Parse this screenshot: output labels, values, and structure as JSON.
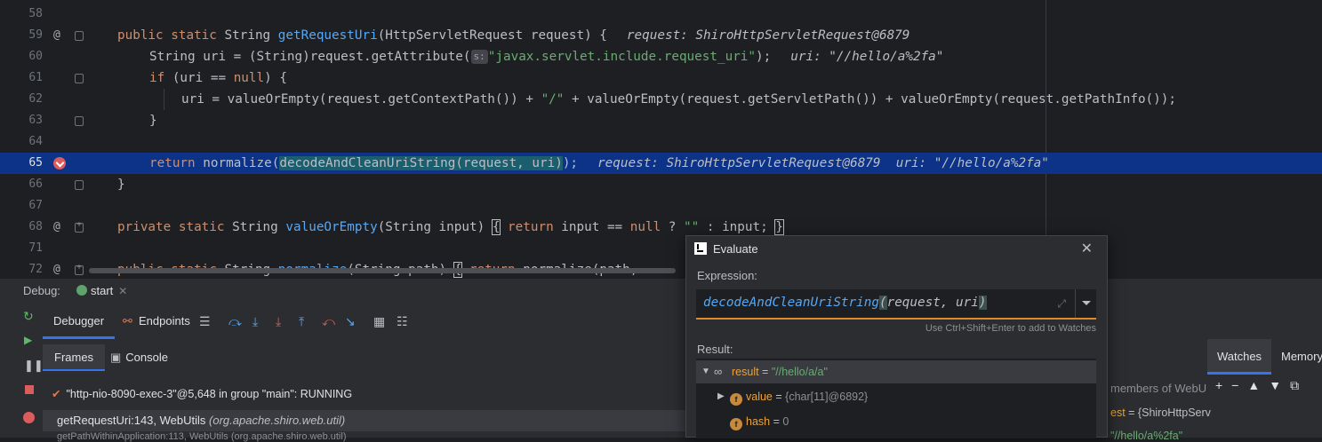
{
  "editor": {
    "lines": [
      {
        "num": "58"
      },
      {
        "num": "59"
      },
      {
        "num": "60"
      },
      {
        "num": "61"
      },
      {
        "num": "62"
      },
      {
        "num": "63"
      },
      {
        "num": "64"
      },
      {
        "num": "65"
      },
      {
        "num": "66"
      },
      {
        "num": "67"
      },
      {
        "num": "68"
      },
      {
        "num": "71"
      },
      {
        "num": "72"
      }
    ],
    "l59": {
      "kw": "public static",
      "sig1": " String ",
      "fn": "getRequestUri",
      "sig2": "(HttpServletRequest request) {",
      "hint": "request: ShiroHttpServletRequest@6879"
    },
    "l60": {
      "pre": "String uri = (String)request.getAttribute(",
      "tag": "s:",
      "str": "\"javax.servlet.include.request_uri\"",
      "post": ");",
      "hint": "uri: \"//hello/a%2fa\""
    },
    "l61": {
      "kw": "if",
      "mid": " (uri == ",
      "kw2": "null",
      "post": ") {"
    },
    "l62": {
      "pre": "uri = valueOrEmpty(request.getContextPath()) + ",
      "str": "\"/\"",
      "post": " + valueOrEmpty(request.getServletPath()) + valueOrEmpty(request.getPathInfo());"
    },
    "l63": {
      "text": "}"
    },
    "l65": {
      "kw": "return",
      "pre": " normalize(",
      "sel": "decodeAndCleanUriString(request, uri)",
      "post": ");",
      "hint": "request: ShiroHttpServletRequest@6879  uri: \"//hello/a%2fa\""
    },
    "l66": {
      "text": "}"
    },
    "l68": {
      "kw": "private static",
      "mid": " String ",
      "fn": "valueOrEmpty",
      "sig": "(String input) ",
      "brace1": "{",
      "kw2": " return",
      "body": " input == ",
      "kw3": "null",
      "q": " ? ",
      "str": "\"\"",
      "tail": " : input;",
      "brace2": "}"
    },
    "l72": {
      "kw": "public static",
      "mid": " String ",
      "fn": "normalize",
      "sig": "(String path) ",
      "brace1": "{",
      "kw2": " return",
      "body": " normalize(path, "
    }
  },
  "debug": {
    "label": "Debug:",
    "session_tab": "start",
    "tabs": {
      "debugger": "Debugger",
      "endpoints": "Endpoints"
    },
    "subtabs": {
      "frames": "Frames",
      "console": "Console"
    },
    "thread": "\"http-nio-8090-exec-3\"@5,648 in group \"main\": RUNNING",
    "frame": {
      "method": "getRequestUri:143, WebUtils",
      "pkg": "(org.apache.shiro.web.util)"
    },
    "frame2": "getPathWithinApplication:113, WebUtils (org.apache.shiro.web.util)",
    "watches": {
      "tab": "Watches",
      "memory": "Memory",
      "text1": "members of WebU",
      "row1_name": "est",
      "row1_val": " = {ShiroHttpServ",
      "row2": "\"//hello/a%2fa\""
    }
  },
  "evaluate": {
    "title": "Evaluate",
    "expression_label": "Expression:",
    "expression": {
      "fn": "decodeAndCleanUriString",
      "open": "(",
      "args": "request, uri",
      "close": ")"
    },
    "hint": "Use Ctrl+Shift+Enter to add to Watches",
    "result_label": "Result:",
    "results": [
      {
        "name": "result",
        "eq": " = ",
        "value": "\"//hello/a/a\""
      },
      {
        "name": "value",
        "eq": " = ",
        "value": "{char[11]@6892}"
      },
      {
        "name": "hash",
        "eq": " = ",
        "value": "0"
      }
    ]
  }
}
